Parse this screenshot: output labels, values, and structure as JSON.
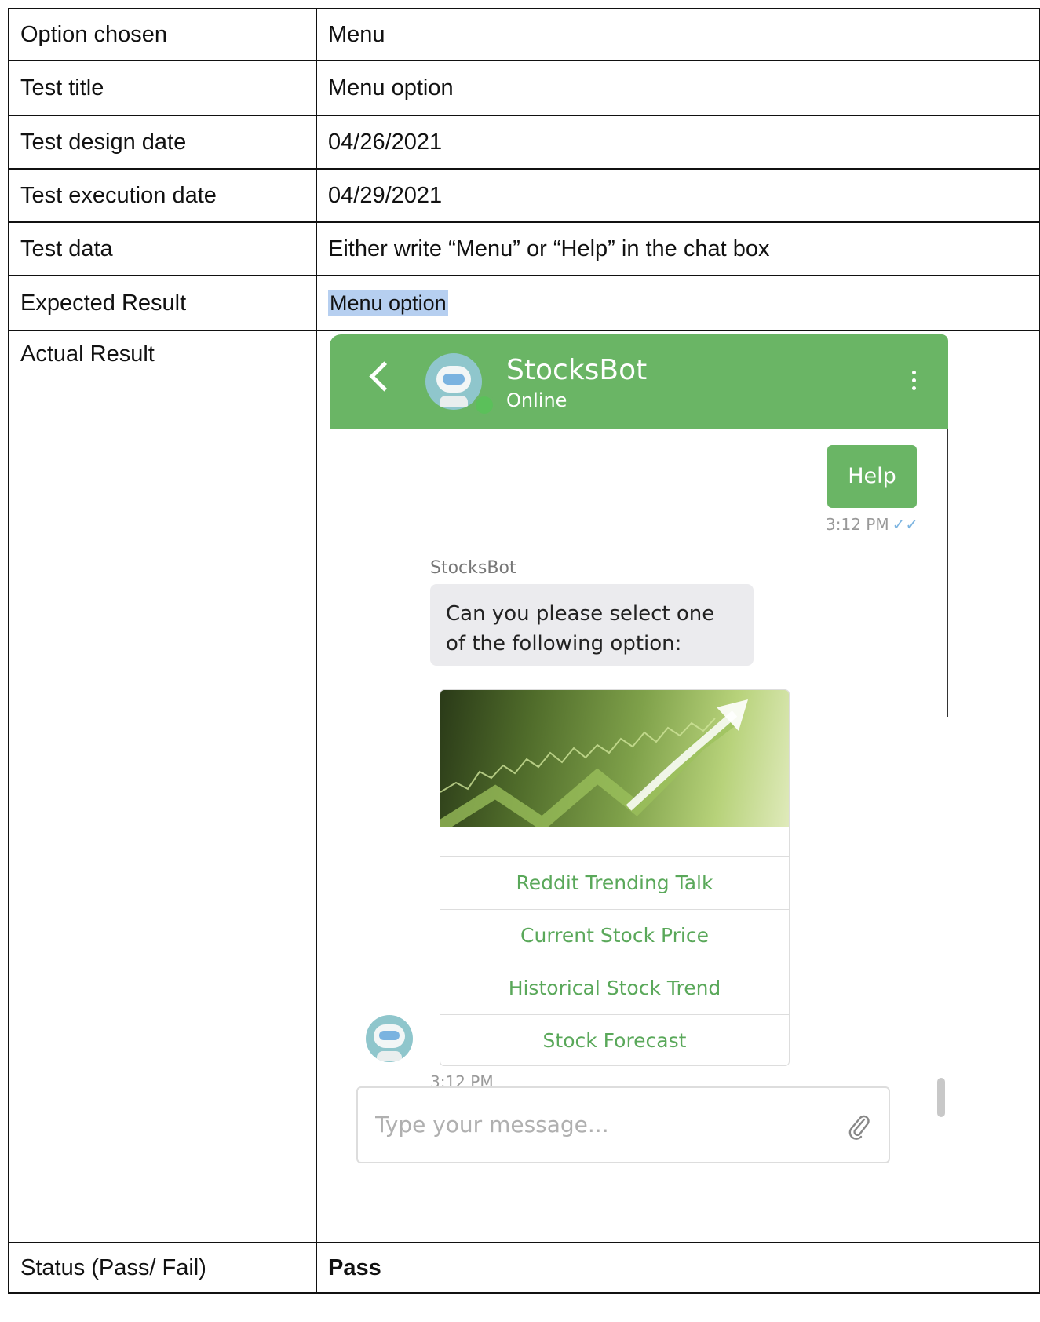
{
  "rows": [
    {
      "label": "Option chosen",
      "value": "Menu"
    },
    {
      "label": "Test title",
      "value": "Menu option"
    },
    {
      "label": "Test design date",
      "value": "04/26/2021"
    },
    {
      "label": "Test execution date",
      "value": "04/29/2021"
    },
    {
      "label": "Test data",
      "value": "Either write “Menu” or “Help” in the chat box"
    },
    {
      "label": "Expected Result",
      "value": "Menu option"
    },
    {
      "label": "Actual Result"
    },
    {
      "label": "Status (Pass/ Fail)",
      "value": "Pass"
    }
  ],
  "chat": {
    "bot_name": "StocksBot",
    "bot_status": "Online",
    "user_message": "Help",
    "user_time": "3:12 PM",
    "sender_name": "StocksBot",
    "bot_message": "Can you please select one of the following option:",
    "options": [
      "Reddit Trending Talk",
      "Current Stock Price",
      "Historical Stock Trend",
      "Stock Forecast"
    ],
    "bot_time": "3:12 PM",
    "input_placeholder": "Type your message...",
    "icons": {
      "back": "chevron-left-icon",
      "menu": "kebab-menu-icon",
      "attach": "paperclip-icon",
      "read": "double-check-icon"
    },
    "colors": {
      "header": "#6ab565",
      "option_text": "#5aa85a",
      "bubble_bot": "#ebebee"
    }
  },
  "colors": {
    "highlight": "#b6cff0"
  }
}
